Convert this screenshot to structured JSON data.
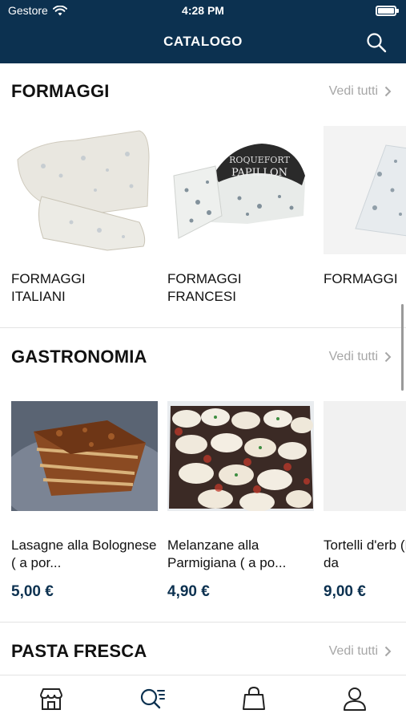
{
  "status_bar": {
    "carrier": "Gestore",
    "time": "4:28 PM"
  },
  "nav": {
    "title": "CATALOGO",
    "search_icon": "search-icon"
  },
  "sections": [
    {
      "title": "FORMAGGI",
      "see_all": "Vedi tutti",
      "items": [
        {
          "name": "FORMAGGI ITALIANI"
        },
        {
          "name": "FORMAGGI FRANCESI"
        },
        {
          "name": "FORMAGGI"
        }
      ]
    },
    {
      "title": "GASTRONOMIA",
      "see_all": "Vedi tutti",
      "items": [
        {
          "name": "Lasagne alla Bolognese ( a por...",
          "price": "5,00 €"
        },
        {
          "name": "Melanzane alla Parmigiana ( a po...",
          "price": "4,90 €"
        },
        {
          "name": "Tortelli d'erb (Porzione da",
          "price": "9,00 €"
        }
      ]
    },
    {
      "title": "PASTA FRESCA",
      "see_all": "Vedi tutti"
    }
  ],
  "tabbar": {
    "tabs": [
      {
        "icon": "store-icon",
        "active": false
      },
      {
        "icon": "search-list-icon",
        "active": true
      },
      {
        "icon": "shopping-bag-icon",
        "active": false
      },
      {
        "icon": "user-icon",
        "active": false
      }
    ]
  },
  "colors": {
    "brand": "#0c3150",
    "see_all": "#a7a7a7",
    "divider": "#e3e3e3"
  }
}
